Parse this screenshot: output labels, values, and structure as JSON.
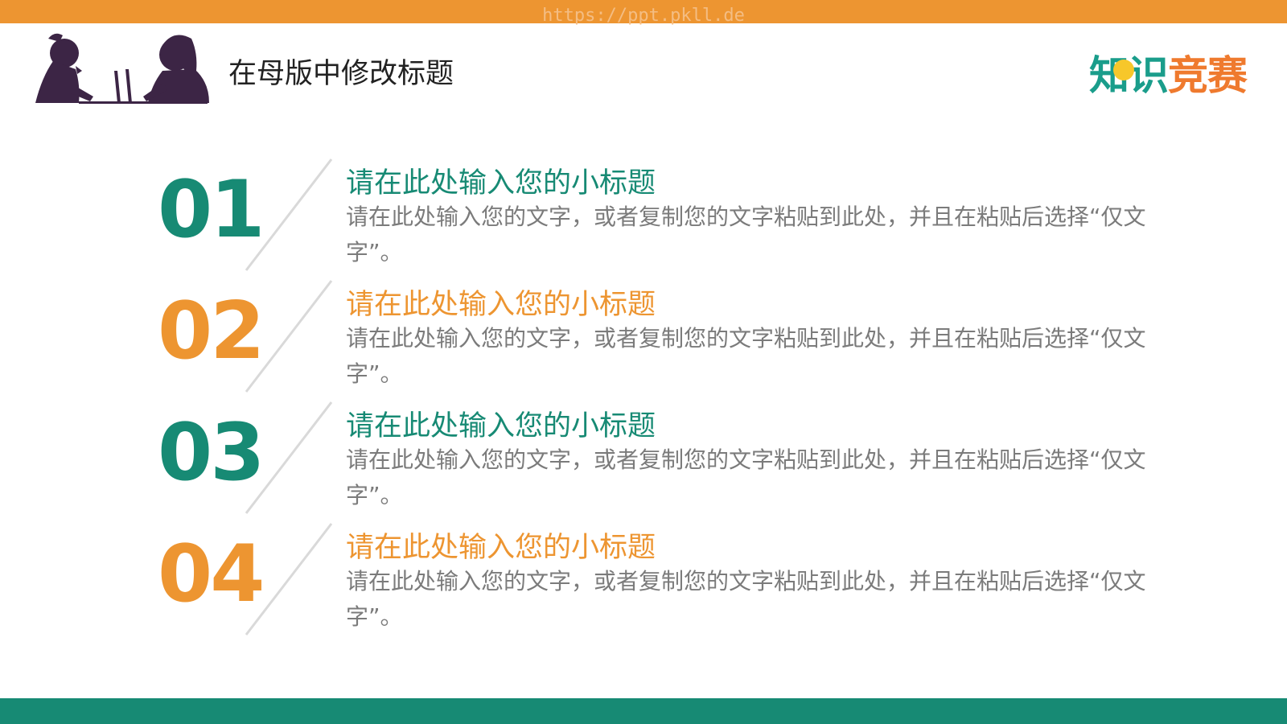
{
  "header": {
    "watermark": "https://ppt.pkll.de",
    "title": "在母版中修改标题",
    "logo": {
      "chars": [
        "知",
        "识",
        "竞",
        "赛"
      ]
    }
  },
  "items": [
    {
      "number": "01",
      "subtitle": "请在此处输入您的小标题",
      "body": "请在此处输入您的文字，或者复制您的文字粘贴到此处，并且在粘贴后选择“仅文字”。",
      "color": "#178a74"
    },
    {
      "number": "02",
      "subtitle": "请在此处输入您的小标题",
      "body": "请在此处输入您的文字，或者复制您的文字粘贴到此处，并且在粘贴后选择“仅文字”。",
      "color": "#ed9531"
    },
    {
      "number": "03",
      "subtitle": "请在此处输入您的小标题",
      "body": "请在此处输入您的文字，或者复制您的文字粘贴到此处，并且在粘贴后选择“仅文字”。",
      "color": "#178a74"
    },
    {
      "number": "04",
      "subtitle": "请在此处输入您的小标题",
      "body": "请在此处输入您的文字，或者复制您的文字粘贴到此处，并且在粘贴后选择“仅文字”。",
      "color": "#ed9531"
    }
  ],
  "colors": {
    "top_bar": "#ed9531",
    "bottom_bar": "#178a74",
    "body_text": "#7b7b7b",
    "silhouette": "#3c2545"
  }
}
